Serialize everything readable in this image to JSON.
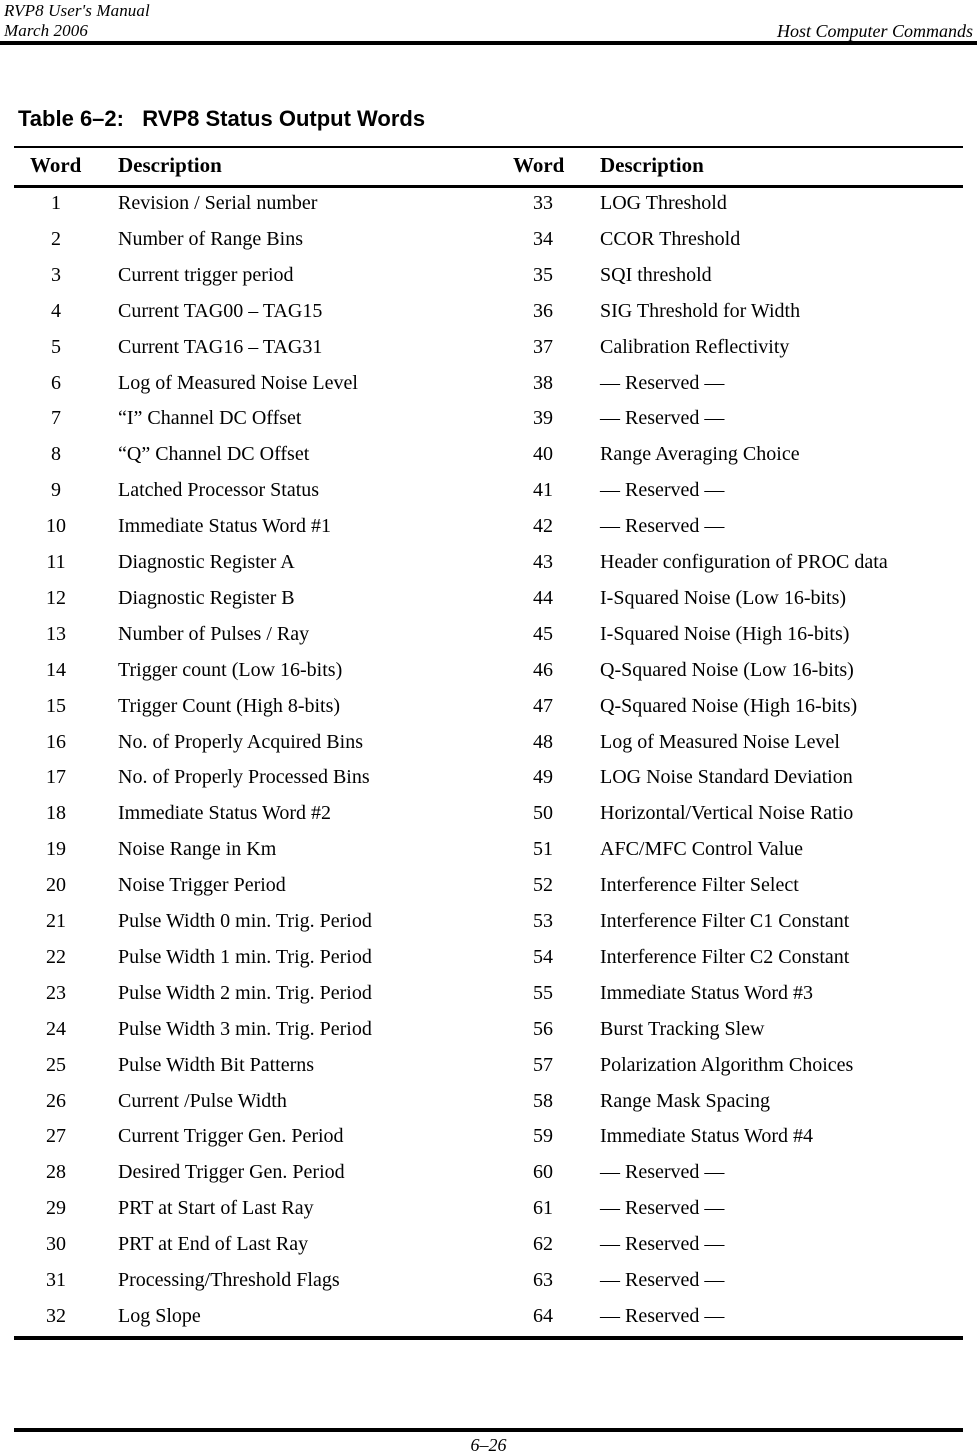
{
  "page_header": {
    "manual_title": "RVP8 User's Manual",
    "date": "March 2006",
    "section": "Host Computer Commands"
  },
  "table": {
    "title": "Table 6–2:   RVP8 Status Output Words",
    "columns": {
      "word_left": "Word",
      "description_left": "Description",
      "word_right": "Word",
      "description_right": "Description"
    },
    "rows": [
      {
        "word_left": "1",
        "desc_left": "Revision / Serial number",
        "word_right": "33",
        "desc_right": "LOG Threshold"
      },
      {
        "word_left": "2",
        "desc_left": "Number of Range Bins",
        "word_right": "34",
        "desc_right": "CCOR Threshold"
      },
      {
        "word_left": "3",
        "desc_left": "Current trigger period",
        "word_right": "35",
        "desc_right": "SQI threshold"
      },
      {
        "word_left": "4",
        "desc_left": "Current TAG00 – TAG15",
        "word_right": "36",
        "desc_right": "SIG Threshold for Width"
      },
      {
        "word_left": "5",
        "desc_left": "Current TAG16 – TAG31",
        "word_right": "37",
        "desc_right": "Calibration Reflectivity"
      },
      {
        "word_left": "6",
        "desc_left": "Log of Measured Noise Level",
        "word_right": "38",
        "desc_right": "— Reserved —"
      },
      {
        "word_left": "7",
        "desc_left": "“I” Channel DC Offset",
        "word_right": "39",
        "desc_right": "— Reserved —"
      },
      {
        "word_left": "8",
        "desc_left": "“Q” Channel DC Offset",
        "word_right": "40",
        "desc_right": "Range Averaging Choice"
      },
      {
        "word_left": "9",
        "desc_left": "Latched Processor Status",
        "word_right": "41",
        "desc_right": "— Reserved —"
      },
      {
        "word_left": "10",
        "desc_left": "Immediate Status Word #1",
        "word_right": "42",
        "desc_right": "— Reserved —"
      },
      {
        "word_left": "11",
        "desc_left": "Diagnostic Register A",
        "word_right": "43",
        "desc_right": "Header configuration of PROC data"
      },
      {
        "word_left": "12",
        "desc_left": "Diagnostic Register B",
        "word_right": "44",
        "desc_right": "I-Squared Noise (Low 16-bits)"
      },
      {
        "word_left": "13",
        "desc_left": "Number of Pulses / Ray",
        "word_right": "45",
        "desc_right": "I-Squared Noise (High 16-bits)"
      },
      {
        "word_left": "14",
        "desc_left": "Trigger count (Low 16-bits)",
        "word_right": "46",
        "desc_right": "Q-Squared Noise (Low 16-bits)"
      },
      {
        "word_left": "15",
        "desc_left": "Trigger Count (High 8-bits)",
        "word_right": "47",
        "desc_right": "Q-Squared Noise (High 16-bits)"
      },
      {
        "word_left": "16",
        "desc_left": "No. of Properly Acquired Bins",
        "word_right": "48",
        "desc_right": "Log of Measured Noise Level"
      },
      {
        "word_left": "17",
        "desc_left": "No. of Properly Processed Bins",
        "word_right": "49",
        "desc_right": "LOG Noise Standard Deviation"
      },
      {
        "word_left": "18",
        "desc_left": "Immediate Status Word #2",
        "word_right": "50",
        "desc_right": "Horizontal/Vertical Noise Ratio"
      },
      {
        "word_left": "19",
        "desc_left": "Noise Range in Km",
        "word_right": "51",
        "desc_right": "AFC/MFC Control Value"
      },
      {
        "word_left": "20",
        "desc_left": "Noise Trigger Period",
        "word_right": "52",
        "desc_right": "Interference Filter Select"
      },
      {
        "word_left": "21",
        "desc_left": "Pulse Width 0 min. Trig. Period",
        "word_right": "53",
        "desc_right": "Interference Filter C1 Constant"
      },
      {
        "word_left": "22",
        "desc_left": "Pulse Width 1 min. Trig. Period",
        "word_right": "54",
        "desc_right": "Interference Filter C2 Constant"
      },
      {
        "word_left": "23",
        "desc_left": "Pulse Width 2 min. Trig. Period",
        "word_right": "55",
        "desc_right": "Immediate Status Word #3"
      },
      {
        "word_left": "24",
        "desc_left": "Pulse Width 3 min. Trig. Period",
        "word_right": "56",
        "desc_right": "Burst Tracking Slew"
      },
      {
        "word_left": "25",
        "desc_left": "Pulse Width Bit Patterns",
        "word_right": "57",
        "desc_right": "Polarization Algorithm Choices"
      },
      {
        "word_left": "26",
        "desc_left": "Current /Pulse Width",
        "word_right": "58",
        "desc_right": "Range Mask Spacing"
      },
      {
        "word_left": "27",
        "desc_left": "Current Trigger Gen. Period",
        "word_right": "59",
        "desc_right": "Immediate Status Word #4"
      },
      {
        "word_left": "28",
        "desc_left": "Desired Trigger Gen. Period",
        "word_right": "60",
        "desc_right": "— Reserved —"
      },
      {
        "word_left": "29",
        "desc_left": "PRT at Start of Last Ray",
        "word_right": "61",
        "desc_right": "— Reserved —"
      },
      {
        "word_left": "30",
        "desc_left": "PRT at End of Last Ray",
        "word_right": "62",
        "desc_right": "— Reserved —"
      },
      {
        "word_left": "31",
        "desc_left": "Processing/Threshold Flags",
        "word_right": "63",
        "desc_right": "— Reserved —"
      },
      {
        "word_left": "32",
        "desc_left": "Log Slope",
        "word_right": "64",
        "desc_right": "— Reserved —"
      }
    ]
  },
  "page_footer": {
    "page_number": "6–26"
  }
}
